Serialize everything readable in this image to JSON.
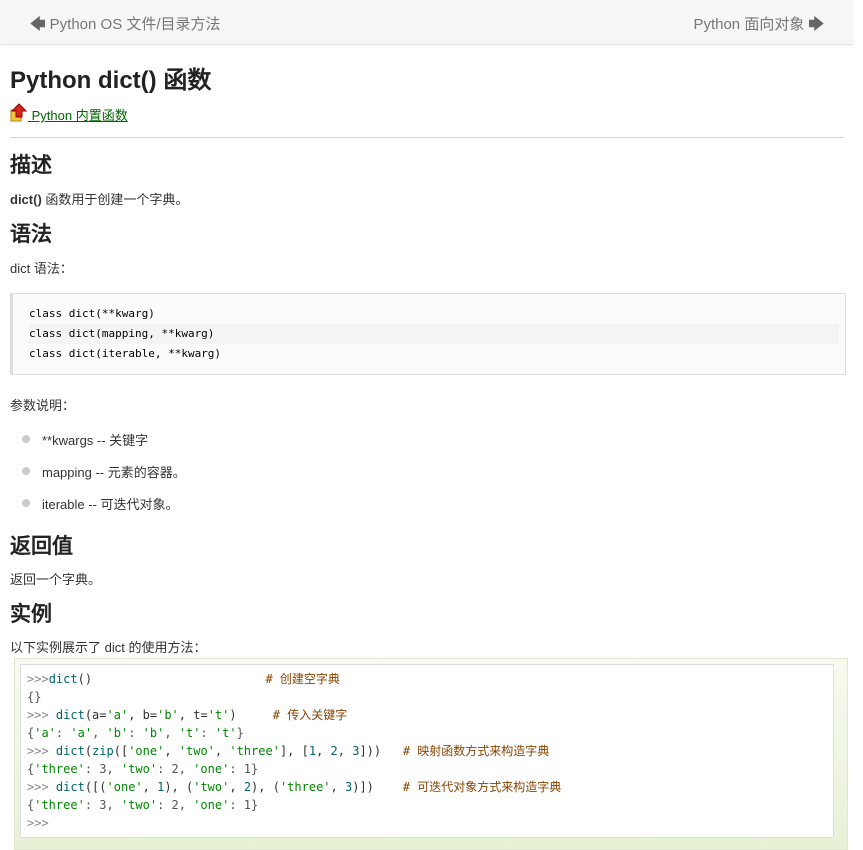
{
  "nav": {
    "prev_label": "Python OS 文件/目录方法",
    "next_label": "Python 面向对象"
  },
  "page": {
    "title": "Python dict() 函数",
    "builtin_link": "Python 内置函数"
  },
  "description": {
    "heading": "描述",
    "func_name": "dict()",
    "text": " 函数用于创建一个字典。"
  },
  "syntax": {
    "heading": "语法",
    "intro": "dict 语法：",
    "lines": [
      "class dict(**kwarg)",
      "class dict(mapping, **kwarg)",
      "class dict(iterable, **kwarg)"
    ]
  },
  "params": {
    "intro": "参数说明：",
    "items": [
      "**kwargs -- 关键字",
      "mapping -- 元素的容器。",
      "iterable -- 可迭代对象。"
    ]
  },
  "returns": {
    "heading": "返回值",
    "text": "返回一个字典。"
  },
  "example": {
    "heading": "实例",
    "intro": "以下实例展示了 dict 的使用方法：",
    "lines": [
      ">>>dict()                        # 创建空字典",
      "{}",
      ">>> dict(a='a', b='b', t='t')     # 传入关键字",
      "{'a': 'a', 'b': 'b', 't': 't'}",
      ">>> dict(zip(['one', 'two', 'three'], [1, 2, 3]))   # 映射函数方式来构造字典",
      "{'three': 3, 'two': 2, 'one': 1}",
      ">>> dict([('one', 1), ('two', 2), ('three', 3)])    # 可迭代对象方式来构造字典",
      "{'three': 3, 'two': 2, 'one': 1}",
      ">>>"
    ]
  }
}
